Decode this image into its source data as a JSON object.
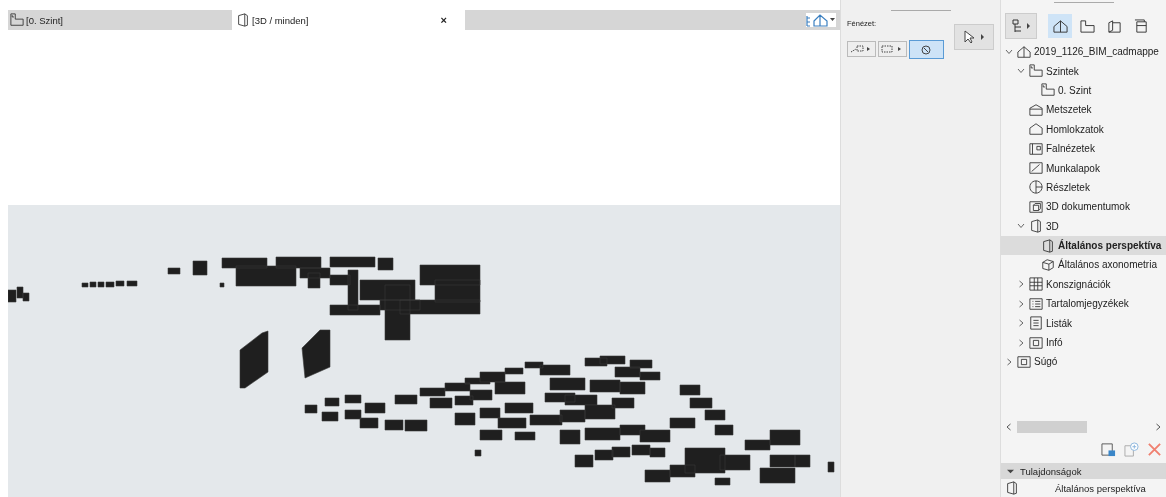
{
  "tabs": [
    {
      "label": "[0. Szint]",
      "kind": "plan",
      "selected": false
    },
    {
      "label": "[3D / minden]",
      "kind": "view3d",
      "selected": true,
      "close": "×"
    }
  ],
  "toolbox": {
    "label": "Fénézet:",
    "tools": [
      {
        "kind": "marquee-dots",
        "selected": false
      },
      {
        "kind": "marquee",
        "selected": false
      },
      {
        "kind": "orbit",
        "selected": true
      }
    ]
  },
  "navigator": {
    "views": [
      {
        "kind": "project",
        "selected": true
      },
      {
        "kind": "layout",
        "selected": false
      },
      {
        "kind": "book",
        "selected": false
      },
      {
        "kind": "publish",
        "selected": false
      }
    ],
    "tree": [
      {
        "label": "2019_1126_BIM_cadmappe",
        "kind": "project",
        "expanded": true,
        "selected": false,
        "children": [
          {
            "label": "Szintek",
            "kind": "levels",
            "expanded": true,
            "selected": false,
            "children": [
              {
                "label": "0. Szint",
                "kind": "levels",
                "selected": false
              }
            ]
          },
          {
            "label": "Metszetek",
            "kind": "sections",
            "selected": false
          },
          {
            "label": "Homlokzatok",
            "kind": "elevations",
            "selected": false
          },
          {
            "label": "Falnézetek",
            "kind": "interior",
            "selected": false
          },
          {
            "label": "Munkalapok",
            "kind": "worksheets",
            "selected": false
          },
          {
            "label": "Részletek",
            "kind": "details",
            "selected": false
          },
          {
            "label": "3D dokumentumok",
            "kind": "documents",
            "selected": false
          },
          {
            "label": "3D",
            "kind": "folder3d",
            "expanded": true,
            "selected": false,
            "children": [
              {
                "label": "Általános perspektíva",
                "kind": "folder3d",
                "selected": true
              },
              {
                "label": "Általános axonometria",
                "kind": "axonometry",
                "selected": false
              }
            ]
          },
          {
            "label": "Konszignációk",
            "kind": "schedules",
            "expanded": false,
            "selected": false
          },
          {
            "label": "Tartalomjegyzékek",
            "kind": "toc",
            "expanded": false,
            "selected": false
          },
          {
            "label": "Listák",
            "kind": "lists",
            "expanded": false,
            "selected": false
          },
          {
            "label": "Infó",
            "kind": "info",
            "expanded": false,
            "selected": false
          }
        ]
      },
      {
        "label": "Súgó",
        "kind": "info",
        "expanded": false,
        "selected": false
      }
    ]
  },
  "properties": {
    "title": "Tulajdonságok",
    "expanded": true,
    "value": "Általános perspektíva"
  }
}
